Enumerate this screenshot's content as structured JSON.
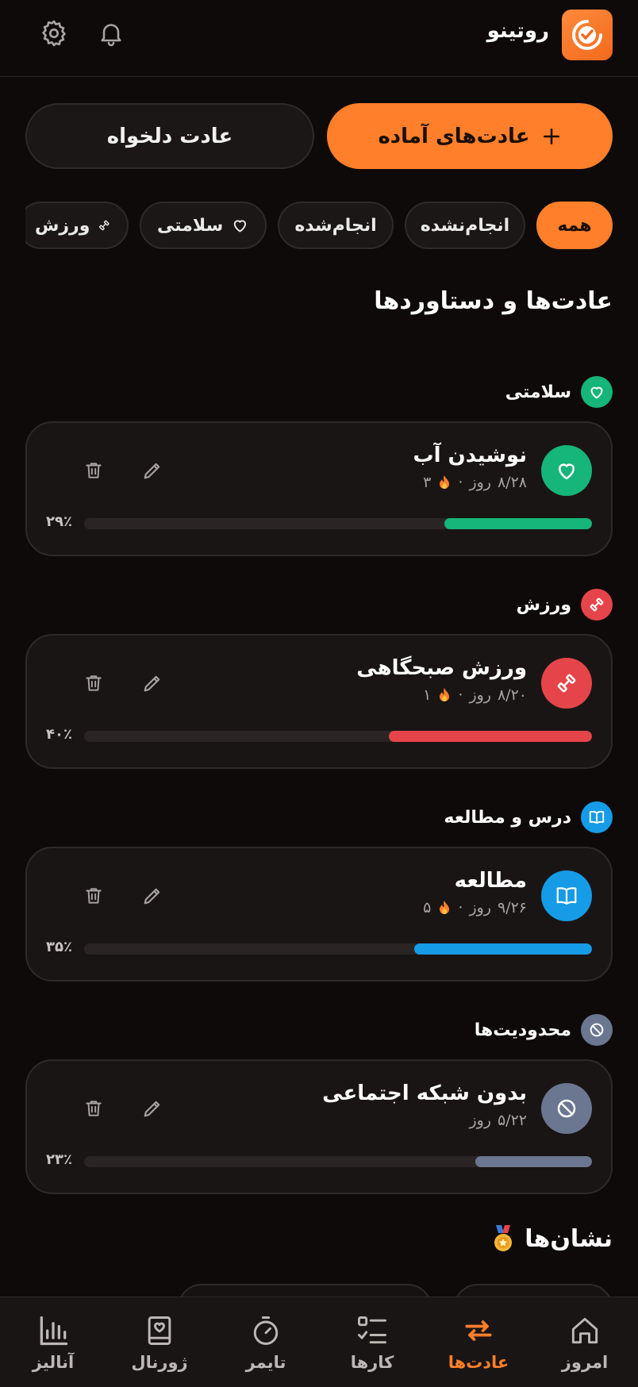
{
  "header": {
    "app_title": "روتینو",
    "logo_icon": "check-circle-icon",
    "settings_icon": "gear-icon",
    "notifications_icon": "bell-icon"
  },
  "actions": {
    "preset_label": "عادت‌های آماده",
    "custom_label": "عادت دلخواه"
  },
  "filters": [
    {
      "label": "همه",
      "active": true
    },
    {
      "label": "انجام‌نشده",
      "active": false
    },
    {
      "label": "انجام‌شده",
      "active": false
    },
    {
      "label": "سلامتی",
      "icon": "heart-icon",
      "active": false
    },
    {
      "label": "ورزش",
      "icon": "dumbbell-icon",
      "active": false
    }
  ],
  "section_title": "عادت‌ها و دستاوردها",
  "categories": [
    {
      "label": "سلامتی",
      "icon": "heart-icon",
      "color": "#16b57a",
      "habit": {
        "name": "نوشیدن آب",
        "count": "۸/۲۸",
        "unit": "روز",
        "streak": "۳",
        "progress": 0.29,
        "progress_label": "۲۹٪"
      }
    },
    {
      "label": "ورزش",
      "icon": "dumbbell-icon",
      "color": "#e5454a",
      "habit": {
        "name": "ورزش صبحگاهی",
        "count": "۸/۲۰",
        "unit": "روز",
        "streak": "۱",
        "progress": 0.4,
        "progress_label": "۴۰٪"
      }
    },
    {
      "label": "درس و مطالعه",
      "icon": "book-icon",
      "color": "#169be6",
      "habit": {
        "name": "مطالعه",
        "count": "۹/۲۶",
        "unit": "روز",
        "streak": "۵",
        "progress": 0.35,
        "progress_label": "۳۵٪"
      }
    },
    {
      "label": "محدودیت‌ها",
      "icon": "block-icon",
      "color": "#6b7690",
      "habit": {
        "name": "بدون شبکه اجتماعی",
        "count": "۵/۲۲",
        "unit": "روز",
        "streak": "",
        "progress": 0.23,
        "progress_label": "۲۳٪"
      }
    }
  ],
  "badges_title": "نشان‌ها",
  "nav": [
    {
      "label": "امروز",
      "icon": "home-icon",
      "active": false
    },
    {
      "label": "عادت‌ها",
      "icon": "repeat-icon",
      "active": true
    },
    {
      "label": "کارها",
      "icon": "checklist-icon",
      "active": false
    },
    {
      "label": "تایمر",
      "icon": "timer-icon",
      "active": false
    },
    {
      "label": "ژورنال",
      "icon": "journal-icon",
      "active": false
    },
    {
      "label": "آنالیز",
      "icon": "chart-bars-icon",
      "active": false
    }
  ],
  "colors": {
    "accent": "#ff7f2a",
    "background": "#0f0a0a",
    "card": "#1a1515"
  }
}
